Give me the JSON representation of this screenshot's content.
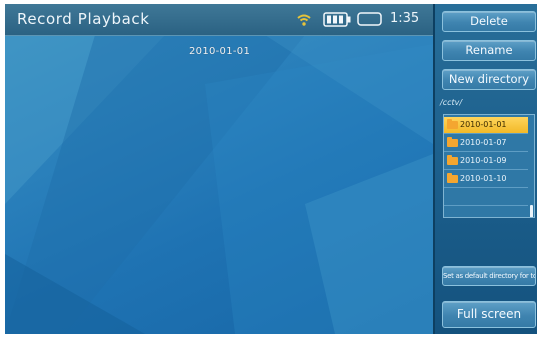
{
  "window": {
    "title": "Record Playback",
    "time": "1:35",
    "overlay_date": "2010-01-01"
  },
  "status_icons": [
    "wifi-icon",
    "battery-icon",
    "sd-card-icon"
  ],
  "sidebar": {
    "buttons": {
      "delete": "Delete",
      "rename": "Rename",
      "new_directory": "New directory",
      "set_default": "Set as default directory for today",
      "full_screen": "Full screen"
    },
    "path": "/cctv/",
    "directories": [
      {
        "label": "2010-01-01",
        "selected": true
      },
      {
        "label": "2010-01-07",
        "selected": false
      },
      {
        "label": "2010-01-09",
        "selected": false
      },
      {
        "label": "2010-01-10",
        "selected": false
      }
    ]
  },
  "colors": {
    "accent": "#2b6283",
    "selection": "#f2b928",
    "folder": "#f4a630"
  }
}
